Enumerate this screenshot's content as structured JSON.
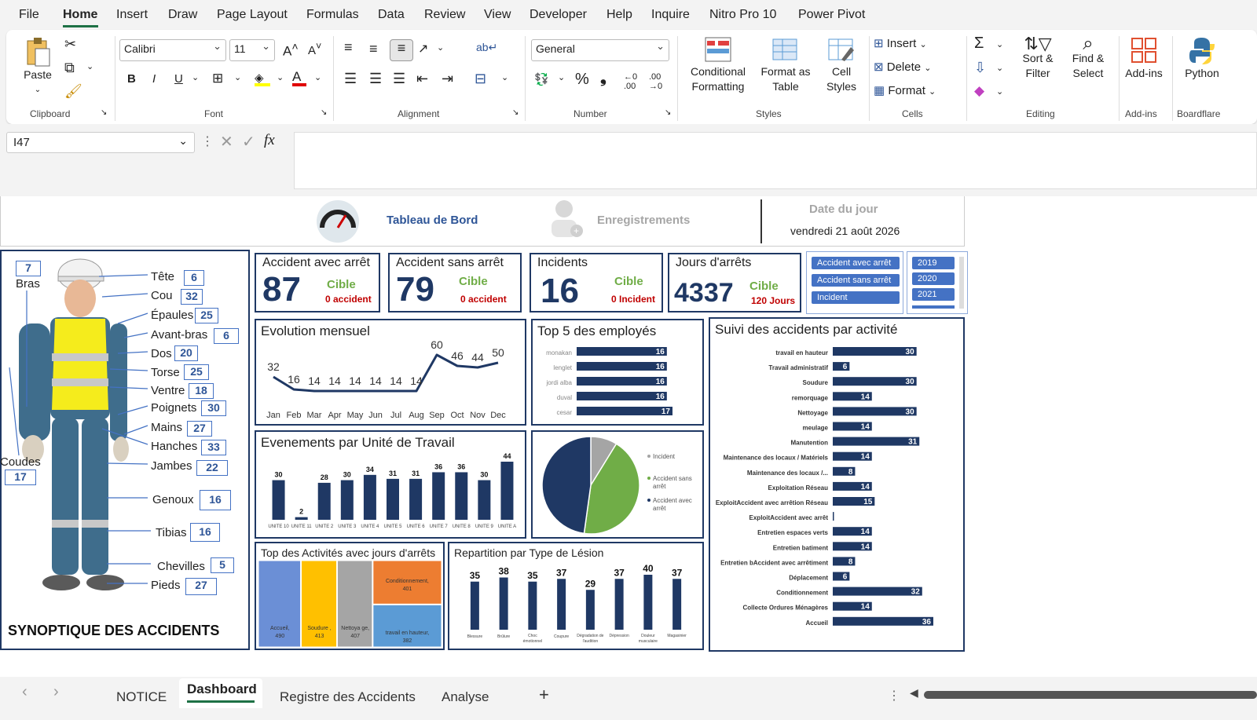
{
  "menu": {
    "items": [
      "File",
      "Home",
      "Insert",
      "Draw",
      "Page Layout",
      "Formulas",
      "Data",
      "Review",
      "View",
      "Developer",
      "Help",
      "Inquire",
      "Nitro Pro 10",
      "Power Pivot"
    ]
  },
  "ribbon": {
    "clipboard": {
      "paste": "Paste",
      "label": "Clipboard"
    },
    "font": {
      "name": "Calibri",
      "size": "11",
      "label": "Font"
    },
    "alignment": {
      "label": "Alignment"
    },
    "number": {
      "format": "General",
      "label": "Number"
    },
    "styles": {
      "conditional": "Conditional Formatting",
      "format_table": "Format as Table",
      "cell_styles": "Cell Styles",
      "label": "Styles"
    },
    "cells": {
      "insert": "Insert",
      "delete": "Delete",
      "format": "Format",
      "label": "Cells"
    },
    "editing": {
      "sort": "Sort & Filter",
      "find": "Find & Select",
      "label": "Editing"
    },
    "addins": {
      "button": "Add-ins",
      "label": "Add-ins"
    },
    "python": {
      "button": "Python",
      "label": "Boardflare"
    }
  },
  "formula": {
    "namebox": "I47",
    "fx": "fx",
    "content": ""
  },
  "header": {
    "dashboard": "Tableau de Bord",
    "records": "Enregistrements",
    "date_label": "Date du jour",
    "date_value": "vendredi 21 août 2026"
  },
  "kpis": [
    {
      "title": "Accident avec arrêt",
      "value": "87",
      "cible": "Cible",
      "target": "0 accident"
    },
    {
      "title": "Accident sans arrêt",
      "value": "79",
      "cible": "Cible",
      "target": "0 accident"
    },
    {
      "title": "Incidents",
      "value": "16",
      "cible": "Cible",
      "target": "0 Incident"
    },
    {
      "title": "Jours d'arrêts",
      "value": "4337",
      "cible": "Cible",
      "target": "120 Jours"
    }
  ],
  "slicers": {
    "types": [
      "Accident avec arrêt",
      "Accident sans arrêt",
      "Incident"
    ],
    "years": [
      "2019",
      "2020",
      "2021"
    ]
  },
  "body": {
    "title": "SYNOPTIQUE DES ACCIDENTS",
    "parts": [
      {
        "label": "Tête",
        "value": "6"
      },
      {
        "label": "Cou",
        "value": "32"
      },
      {
        "label": "Épaules",
        "value": "25"
      },
      {
        "label": "Avant-bras",
        "value": "6"
      },
      {
        "label": "Dos",
        "value": "20"
      },
      {
        "label": "Torse",
        "value": "25"
      },
      {
        "label": "Ventre",
        "value": "18"
      },
      {
        "label": "Poignets",
        "value": "30"
      },
      {
        "label": "Mains",
        "value": "27"
      },
      {
        "label": "Hanches",
        "value": "33"
      },
      {
        "label": "Jambes",
        "value": "22"
      },
      {
        "label": "Genoux",
        "value": "16"
      },
      {
        "label": "Tibias",
        "value": "16"
      },
      {
        "label": "Chevilles",
        "value": "5"
      },
      {
        "label": "Pieds",
        "value": "27"
      }
    ],
    "bras": {
      "label": "Bras",
      "value": "7"
    },
    "coudes": {
      "label": "Coudes",
      "value": "17"
    }
  },
  "tabs": {
    "items": [
      "NOTICE",
      "Dashboard",
      "Registre des Accidents",
      "Analyse"
    ],
    "add": "+"
  },
  "chart_data": [
    {
      "type": "line",
      "title": "Evolution mensuel",
      "categories": [
        "Jan",
        "Feb",
        "Mar",
        "Apr",
        "May",
        "Jun",
        "Jul",
        "Aug",
        "Sep",
        "Oct",
        "Nov",
        "Dec"
      ],
      "values": [
        32,
        16,
        14,
        14,
        14,
        14,
        14,
        14,
        60,
        46,
        44,
        50
      ]
    },
    {
      "type": "bar",
      "title": "Top 5 des employés",
      "orientation": "horizontal",
      "categories": [
        "monakan",
        "lenglet",
        "jordi alba",
        "duval",
        "cesar"
      ],
      "values": [
        16,
        16,
        16,
        16,
        17
      ],
      "color": "#1f3864"
    },
    {
      "type": "bar",
      "title": "Evenements par Unité de Travail",
      "categories": [
        "UNITE 10",
        "UNITE 11",
        "UNITE 2",
        "UNITE 3",
        "UNITE 4",
        "UNITE 5",
        "UNITE 6",
        "UNITE 7",
        "UNITE 8",
        "UNITE 9",
        "UNITE A"
      ],
      "values": [
        30,
        2,
        28,
        30,
        34,
        31,
        31,
        36,
        36,
        30,
        44
      ],
      "color": "#1f3864"
    },
    {
      "type": "pie",
      "categories": [
        "Incident",
        "Accident sans arrêt",
        "Accident avec arrêt"
      ],
      "values": [
        16,
        79,
        87
      ],
      "colors": [
        "#a5a5a5",
        "#70ad47",
        "#1f3864"
      ]
    },
    {
      "type": "bar",
      "title": "Suivi des accidents par activité",
      "orientation": "horizontal",
      "categories": [
        "travail en hauteur",
        "Travail administratif",
        "Soudure",
        "remorquage",
        "Nettoyage",
        "meulage",
        "Manutention",
        "Maintenance des locaux / Matériels",
        "Maintenance des locaux /...",
        "Exploitation Réseau",
        "ExploitAccident avec arrêtion Réseau",
        "ExploitAccident avec arrêt",
        "Entretien espaces verts",
        "Entretien batiment",
        "Entretien bAccident avec arrêtiment",
        "Déplacement",
        "Conditionnement",
        "Collecte Ordures Ménagères",
        "Accueil"
      ],
      "values": [
        30,
        6,
        30,
        14,
        30,
        14,
        31,
        14,
        8,
        14,
        15,
        0,
        14,
        14,
        8,
        6,
        32,
        14,
        36
      ],
      "color": "#1f3864"
    },
    {
      "type": "treemap",
      "title": "Top des Activités avec jours d'arrêts",
      "items": [
        {
          "label": "Accueil, 490",
          "value": 490,
          "color": "#6b8fd6"
        },
        {
          "label": "Soudure , 413",
          "value": 413,
          "color": "#ffc000"
        },
        {
          "label": "Nettoya ge, 407",
          "value": 407,
          "color": "#a5a5a5"
        },
        {
          "label": "Conditionnement, 401",
          "value": 401,
          "color": "#ed7d31"
        },
        {
          "label": "travail en hauteur, 382",
          "value": 382,
          "color": "#5b9bd5"
        }
      ]
    },
    {
      "type": "bar",
      "title": "Repartition par Type de Lésion",
      "categories": [
        "Blessure",
        "Brûlure",
        "Choc émotionnel",
        "Coupure",
        "Dégradation de l'audition",
        "Dépression",
        "Douleur musculaire",
        "Magasinier"
      ],
      "values": [
        35,
        38,
        35,
        37,
        29,
        37,
        40,
        37
      ],
      "color": "#1f3864"
    }
  ]
}
